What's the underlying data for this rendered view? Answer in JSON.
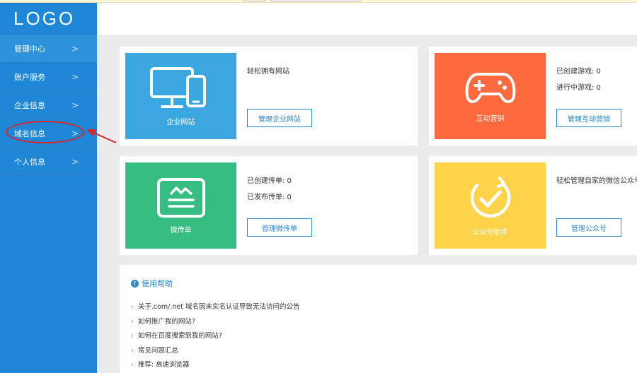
{
  "brand": {
    "logo_text": "LOGO"
  },
  "sidebar": {
    "items": [
      {
        "label": "管理中心"
      },
      {
        "label": "账户服务"
      },
      {
        "label": "企业信息"
      },
      {
        "label": "域名信息"
      },
      {
        "label": "个人信息"
      }
    ]
  },
  "cards": {
    "website": {
      "tile_label": "企业网站",
      "lines": [
        "轻松拥有网站"
      ],
      "button": "管理企业网站",
      "color": "#3ba7e0"
    },
    "marketing": {
      "tile_label": "互动营销",
      "lines": [
        "已创建游戏: 0",
        "进行中游戏: 0"
      ],
      "button": "管理互动营销",
      "color": "#fd6a3d"
    },
    "flyer": {
      "tile_label": "微传单",
      "lines": [
        "已创建传单: 0",
        "已发布传单: 0"
      ],
      "button": "管理微传单",
      "color": "#36bd82"
    },
    "wechat": {
      "tile_label": "公众号助手",
      "lines": [
        "轻松管理自家的微信公众号"
      ],
      "button": "管理公众号",
      "color": "#fdd449"
    }
  },
  "help": {
    "title": "使用帮助",
    "items": [
      "关于.com/.net 域名因未实名认证导致无法访问的公告",
      "如何推广我的网站?",
      "如何在百度搜索到我的网站?",
      "常见问题汇总",
      "推荐: 高速浏览器"
    ]
  }
}
